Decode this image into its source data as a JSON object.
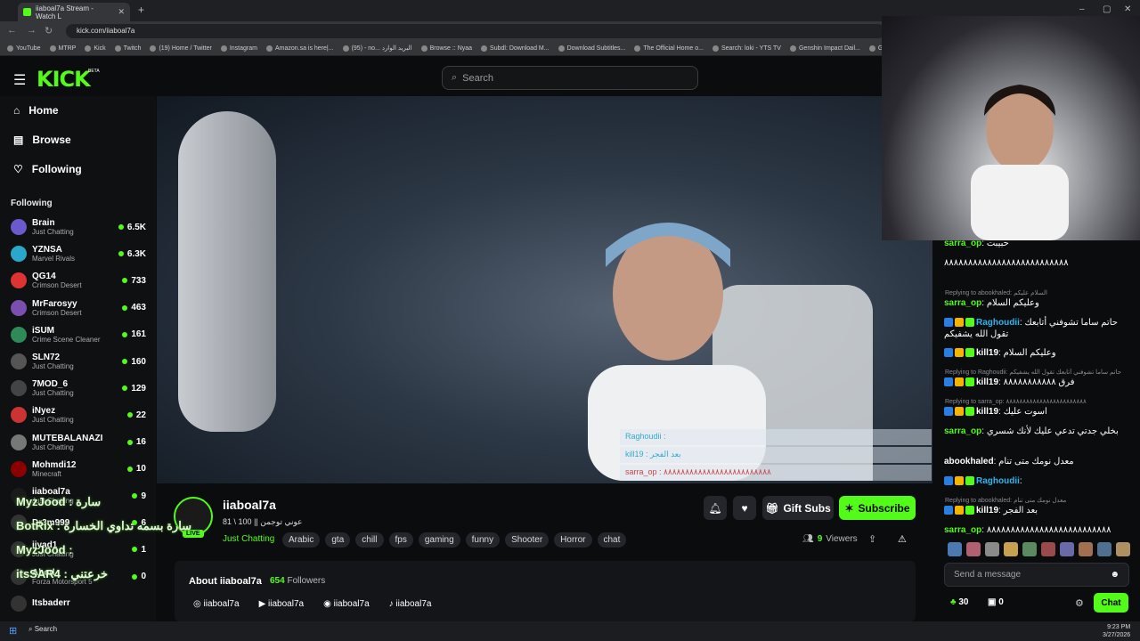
{
  "browser": {
    "tab_title": "iiaboal7a Stream - Watch L",
    "tab_close": "✕",
    "new_tab": "+",
    "url": "kick.com/iiaboal7a",
    "bookmarks": [
      "YouTube",
      "MTRP",
      "Kick",
      "Twitch",
      "(19) Home / Twitter",
      "Instagram",
      "Amazon.sa is here|...",
      "(95) - no... البريد الوارد",
      "Browse :: Nyaa",
      "Subdl: Download M...",
      "Download Subtitles...",
      "The Official Home o...",
      "Search: loki - YTS TV",
      "Genshin Impact Dail...",
      "Ge"
    ]
  },
  "header": {
    "logo": "KICK",
    "logo_badge": "BETA",
    "search_placeholder": "Search"
  },
  "nav": {
    "home": "Home",
    "browse": "Browse",
    "following": "Following"
  },
  "sidebar": {
    "following_title": "Following",
    "channels": [
      {
        "name": "Brain",
        "category": "Just Chatting",
        "viewers": "6.5K",
        "color": "#6a5acd"
      },
      {
        "name": "YZNSA",
        "category": "Marvel Rivals",
        "viewers": "6.3K",
        "color": "#2aa7c9"
      },
      {
        "name": "QG14",
        "category": "Crimson Desert",
        "viewers": "733",
        "color": "#d33"
      },
      {
        "name": "MrFarosyy",
        "category": "Crimson Desert",
        "viewers": "463",
        "color": "#7b4fb0"
      },
      {
        "name": "iSUM",
        "category": "Crime Scene Cleaner",
        "viewers": "161",
        "color": "#2e8b57"
      },
      {
        "name": "SLN72",
        "category": "Just Chatting",
        "viewers": "160",
        "color": "#555"
      },
      {
        "name": "7MOD_6",
        "category": "Just Chatting",
        "viewers": "129",
        "color": "#444"
      },
      {
        "name": "iNyez",
        "category": "Just Chatting",
        "viewers": "22",
        "color": "#c33"
      },
      {
        "name": "MUTEBALANAZI",
        "category": "Just Chatting",
        "viewers": "16",
        "color": "#777"
      },
      {
        "name": "Mohmdi12",
        "category": "Minecraft",
        "viewers": "10",
        "color": "#8b0000"
      },
      {
        "name": "iiaboal7a",
        "category": "Just Chatting",
        "viewers": "9",
        "color": "#1a1a1a"
      },
      {
        "name": "Dr3m999",
        "category": "",
        "viewers": "6",
        "color": "#333"
      },
      {
        "name": "iiyad1",
        "category": "Just Chatting",
        "viewers": "1",
        "color": "#333"
      },
      {
        "name": "Abod",
        "category": "Forza Motorsport 5",
        "viewers": "0",
        "color": "#333"
      },
      {
        "name": "Itsbaderr",
        "category": "",
        "viewers": "",
        "color": "#333"
      }
    ]
  },
  "overlay_chat": {
    "lines": [
      "Raghoudii :",
      "kill19 : بعد الفجر",
      "sarra_op : ٨٨٨٨٨٨٨٨٨٨٨٨٨٨٨٨٨٨٨٨٨٨٨٨٨"
    ]
  },
  "ticker": [
    "MyzJood : سارة",
    "BotRix : سارة بسمه تداوي الخسارة",
    "MyzJood :",
    "itsSAR4 : خرعتني"
  ],
  "streamer": {
    "name": "iiaboal7a",
    "live": "LIVE",
    "title": "عوني توجمن || 100 \\ 81",
    "category": "Just Chatting",
    "tags": [
      "Arabic",
      "gta",
      "chill",
      "fps",
      "gaming",
      "funny",
      "Shooter",
      "Horror",
      "chat"
    ],
    "gift_subs": "Gift Subs",
    "subscribe": "Subscribe",
    "viewers_count": "9",
    "viewers_label": "Viewers"
  },
  "about": {
    "title": "About iiaboal7a",
    "followers_count": "654",
    "followers_label": "Followers",
    "socials": [
      "iiaboal7a",
      "iiaboal7a",
      "iiaboal7a",
      "iiaboal7a"
    ]
  },
  "chat": {
    "messages": [
      {
        "user": "sarra_op",
        "text": "حبيبت",
        "user_color": "#53fc18"
      },
      {
        "user": "",
        "text": "٨٨٨٨٨٨٨٨٨٨٨٨٨٨٨٨٨٨٨٨٨٨٨٨٨٨",
        "user_color": "#fff"
      },
      {
        "reply": "Replying to abookhaled: السلام عليكم"
      },
      {
        "user": "sarra_op",
        "text": "وعليكم السلام",
        "user_color": "#53fc18"
      },
      {
        "user": "Raghoudii",
        "text": "حاتم ساما تشوفني أتابعك تقول الله يشفيكم",
        "user_color": "#2ab7f0"
      },
      {
        "user": "kill19",
        "text": "وعليكم السلام",
        "user_color": "#fff"
      },
      {
        "reply": "Replying to Raghoudii: حاتم ساما تشوفني أتابعك تقول الله يشفيكم"
      },
      {
        "user": "kill19",
        "text": "فرق ٨٨٨٨٨٨٨٨٨٨٨",
        "user_color": "#fff"
      },
      {
        "reply": "Replying to sarra_op: ٨٨٨٨٨٨٨٨٨٨٨٨٨٨٨٨٨٨٨٨٨٨٨٨"
      },
      {
        "user": "kill19",
        "text": "اسوت عليك",
        "user_color": "#fff"
      },
      {
        "user": "sarra_op",
        "text": "بخلي جدتي تدعي عليك لأنك شسري",
        "user_color": "#53fc18"
      },
      {
        "user": "abookhaled",
        "text": "معدل نومك متى تنام",
        "user_color": "#fff"
      },
      {
        "user": "Raghoudii",
        "text": "",
        "user_color": "#2ab7f0"
      },
      {
        "reply": "Replying to abookhaled: معدل نومك متى تنام"
      },
      {
        "user": "kill19",
        "text": "بعد الفجر",
        "user_color": "#fff"
      },
      {
        "user": "sarra_op",
        "text": "٨٨٨٨٨٨٨٨٨٨٨٨٨٨٨٨٨٨٨٨٨٨٨٨٨٨",
        "user_color": "#53fc18"
      }
    ],
    "input_placeholder": "Send a message",
    "kicks": "30",
    "gifts": "0",
    "chat_button": "Chat"
  },
  "taskbar": {
    "search": "Search",
    "time": "9:23 PM",
    "date": "3/27/2026"
  }
}
